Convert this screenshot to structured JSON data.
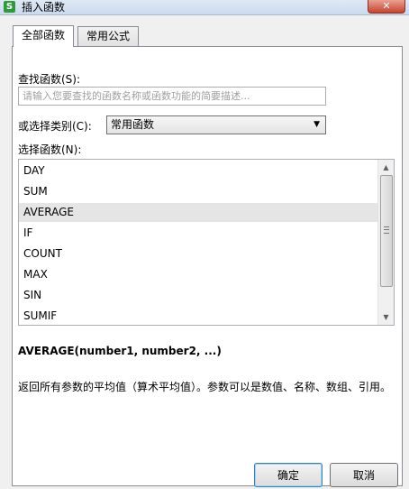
{
  "window": {
    "title": "插入函数",
    "app_icon_letter": "S",
    "close_glyph": "✕"
  },
  "tabs": [
    {
      "label": "全部函数",
      "active": true
    },
    {
      "label": "常用公式",
      "active": false
    }
  ],
  "search": {
    "label": "查找函数(S):",
    "placeholder": "请输入您要查找的函数名称或函数功能的简要描述..."
  },
  "category": {
    "label": "或选择类别(C):",
    "value": "常用函数"
  },
  "function_list": {
    "label": "选择函数(N):",
    "items": [
      "DAY",
      "SUM",
      "AVERAGE",
      "IF",
      "COUNT",
      "MAX",
      "SIN",
      "SUMIF"
    ],
    "selected": "AVERAGE"
  },
  "signature": "AVERAGE(number1, number2, ...)",
  "description": "返回所有参数的平均值（算术平均值）。参数可以是数值、名称、数组、引用。",
  "buttons": {
    "ok": "确定",
    "cancel": "取消"
  }
}
